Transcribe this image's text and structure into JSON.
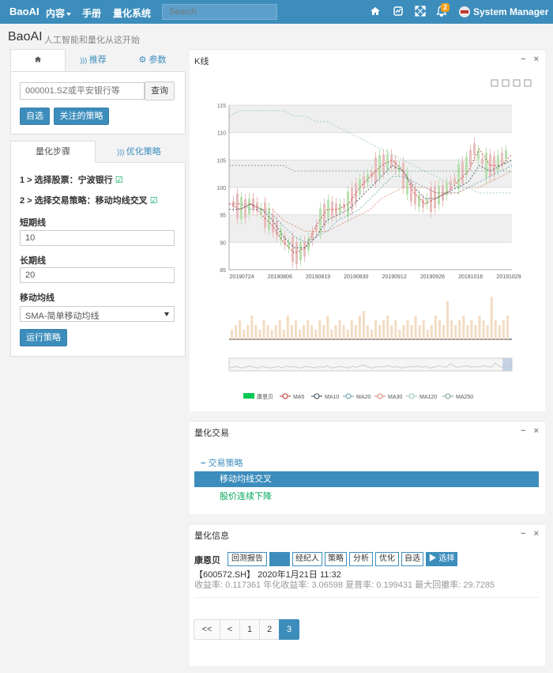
{
  "navbar": {
    "brand": "BaoAI",
    "menu": [
      "内容",
      "手册",
      "量化系统"
    ],
    "search_placeholder": "Search",
    "notification_count": "2",
    "user": "System Manager",
    "icons": [
      "home-icon",
      "stock-icon",
      "expand-icon",
      "bell-icon"
    ]
  },
  "page": {
    "title": "BaoAI",
    "subtitle": "人工智能和量化从这开始"
  },
  "left_top": {
    "tabs": [
      "",
      "推荐",
      "参数"
    ],
    "stock_input_placeholder": "000001.SZ或平安银行等",
    "query_label": "查询",
    "self_select_label": "自选",
    "followed_strategy_label": "关注的策略"
  },
  "left_bottom": {
    "tabs": [
      "量化步骤",
      "优化策略"
    ],
    "step1": "1 > 选择股票：宁波银行",
    "step2": "2 > 选择交易策略：移动均线交叉",
    "short_label": "短期线",
    "short_value": "10",
    "long_label": "长期线",
    "long_value": "20",
    "ma_label": "移动均线",
    "ma_value": "SMA-简单移动均线",
    "run_label": "运行策略"
  },
  "kline_box": {
    "title": "K线",
    "close": "×",
    "minimize": "−"
  },
  "chart_data": {
    "type": "line",
    "x_tick_labels": [
      "20190724",
      "20190806",
      "20190819",
      "20190830",
      "20190912",
      "20190926",
      "20191016",
      "20191029"
    ],
    "ylim": [
      85,
      115
    ],
    "y_ticks": [
      85,
      90,
      95,
      100,
      105,
      110,
      115
    ],
    "legend": [
      "康恩贝",
      "MA5",
      "MA10",
      "MA20",
      "MA30",
      "MA120",
      "MA250"
    ],
    "colors": {
      "MA5": "#c23531",
      "MA10": "#2f4554",
      "MA20": "#61a0a8",
      "MA30": "#d48265",
      "MA120": "#91c7ae",
      "MA250": "#749f83",
      "up": "#e8bcbc",
      "down": "#b9e0b0"
    },
    "series": [
      {
        "name": "MA5",
        "values": [
          97,
          96,
          97,
          95,
          93,
          90,
          88,
          89,
          93,
          96,
          96,
          97,
          100,
          102,
          104,
          105,
          103,
          99,
          97,
          98,
          99,
          101,
          103,
          107,
          104,
          104,
          106
        ]
      },
      {
        "name": "MA10",
        "values": [
          96,
          96,
          97,
          96,
          94,
          91,
          89,
          89,
          91,
          94,
          95,
          96,
          98,
          100,
          102,
          104,
          103,
          100,
          98,
          98,
          99,
          100,
          101,
          104,
          103,
          104,
          105
        ]
      },
      {
        "name": "MA20",
        "values": [
          97,
          97,
          96,
          96,
          95,
          93,
          91,
          90,
          91,
          92,
          94,
          95,
          96,
          98,
          100,
          102,
          102,
          101,
          100,
          99,
          99,
          99,
          100,
          101,
          102,
          103,
          104
        ]
      },
      {
        "name": "MA30",
        "values": [
          97,
          97,
          97,
          96,
          96,
          94,
          93,
          92,
          92,
          92,
          93,
          94,
          95,
          96,
          98,
          99,
          100,
          100,
          100,
          99,
          99,
          99,
          100,
          100,
          101,
          102,
          103
        ]
      },
      {
        "name": "MA120",
        "values": [
          113,
          114,
          114,
          114,
          114,
          114,
          113,
          113,
          112,
          112,
          111,
          110,
          109,
          108,
          107,
          106,
          105,
          104,
          103,
          102,
          101,
          100,
          100,
          99,
          99,
          99,
          99
        ]
      },
      {
        "name": "MA250",
        "values": [
          104,
          104,
          104,
          104,
          104,
          104,
          103,
          103,
          103,
          103,
          103,
          103,
          103,
          103,
          103,
          103,
          103,
          103,
          103,
          103,
          103,
          103,
          103,
          103,
          103,
          103,
          103
        ]
      }
    ],
    "volume": [
      2,
      3,
      4,
      2,
      3,
      5,
      3,
      2,
      4,
      3,
      2,
      3,
      4,
      2,
      5,
      3,
      4,
      2,
      3,
      4,
      3,
      2,
      4,
      3,
      5,
      2,
      3,
      4,
      3,
      2,
      4,
      3,
      5,
      6,
      3,
      2,
      4,
      3,
      4,
      5,
      3,
      4,
      2,
      3,
      4,
      3,
      5,
      3,
      4,
      2,
      3,
      5,
      4,
      3,
      8,
      4,
      3,
      4,
      5,
      3,
      4,
      3,
      5,
      4,
      3,
      9,
      4,
      3,
      4,
      5
    ]
  },
  "trade_box": {
    "title": "量化交易",
    "root": "交易策略",
    "items": [
      "移动均线交叉",
      "股价连续下降"
    ]
  },
  "info_box": {
    "title": "量化信息",
    "name": "康恩贝",
    "buttons": [
      "回测报告",
      "",
      "经纪人",
      "策略",
      "分析",
      "优化",
      "自选",
      "▶ 选择"
    ],
    "line1": "【600572.SH】 2020年1月21日 11:32",
    "line2": "收益率: 0.117361   年化收益率: 3.06598   夏普率: 0.199431   最大回撤率: 29.7285",
    "pages": [
      "<<",
      "<",
      "1",
      "2",
      "3"
    ]
  }
}
